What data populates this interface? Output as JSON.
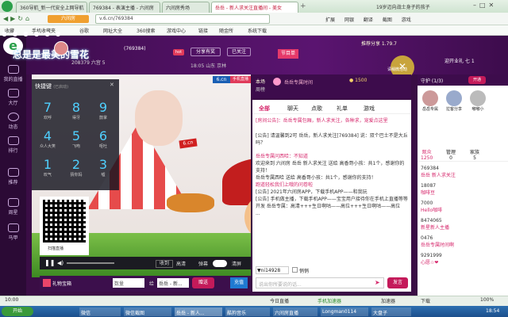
{
  "browser": {
    "tabs": [
      {
        "label": "360导航_新一代安全上网导航",
        "active": false
      },
      {
        "label": "769384 - 表演主播 - 六间房",
        "active": false
      },
      {
        "label": "六间房秀场",
        "active": false
      },
      {
        "label": "岳岳 - 新人求关注直播间 - 美女",
        "active": true
      },
      {
        "label": "19岁迈向战士身子的孩子",
        "active": false
      }
    ],
    "url": "v.6.cn/769384",
    "sidebar_label": "六间房",
    "address_right": [
      "扩展",
      "网银",
      "翻译",
      "截图",
      "游戏"
    ],
    "bookmarks": [
      "收藏",
      "手机收藏夹",
      "谷歌",
      "网址大全",
      "360搜索",
      "游戏中心",
      "链接",
      "随金所",
      "系统下载"
    ]
  },
  "site_sidebar": [
    {
      "label": "我的直播"
    },
    {
      "label": "大厅"
    },
    {
      "label": "动态"
    },
    {
      "label": "排行"
    },
    {
      "label": "推荐"
    },
    {
      "label": "周星"
    },
    {
      "label": "马甲"
    }
  ],
  "header": {
    "overlay_title": "总是是最美的雪花",
    "room_number": "769384",
    "anchor_id": "208379",
    "level_text": "六宫 5",
    "hot_label": "hot",
    "share_label": "分享有奖",
    "follow_label": "已关注",
    "time": "18:05",
    "location_labels": [
      "山东",
      "京林"
    ],
    "room_title": "节目单",
    "recommend_text": "推荐分享 1.79.7",
    "host_reward": "岳岳专属时间",
    "coin": "1500",
    "bubble_text": "请稍微活动",
    "announce": "迎开业礼 七 1"
  },
  "video": {
    "logo": "6.cn",
    "badge": "手机直播",
    "overlay_badge": "6.cn"
  },
  "keypad": {
    "title": "快捷键",
    "subtitle": "(已启动)",
    "keys": [
      {
        "num": "7",
        "label": "欢呼"
      },
      {
        "num": "8",
        "label": "得牙"
      },
      {
        "num": "9",
        "label": "鼓掌"
      },
      {
        "num": "4",
        "label": "众人大笑"
      },
      {
        "num": "5",
        "label": "飞吻"
      },
      {
        "num": "6",
        "label": "呕吐"
      },
      {
        "num": "1",
        "label": "叹气"
      },
      {
        "num": "2",
        "label": "猜你妈"
      },
      {
        "num": "3",
        "label": "嘘"
      }
    ]
  },
  "qr": {
    "label": "扫描直播"
  },
  "controls": {
    "follow": "收到",
    "gift": "高清",
    "hd": "清屏",
    "btn": "弹幕"
  },
  "gift_bar": {
    "gift_label": "礼物宝箱",
    "qty_label": "数量",
    "to_label": "给",
    "to_name": "岳岳 - 新...",
    "send_label": "赠送",
    "recharge_label": "充值"
  },
  "chat": {
    "header_tabs": [
      "本场",
      "周榜"
    ],
    "tabs": [
      "全部",
      "聊天",
      "点歌",
      "礼单",
      "游戏"
    ],
    "lines": [
      "[房间公告]：岳岳专属包厢，新人求关注，各种求，宠爱点这里",
      "",
      "[公告] 请温馨到2可 岳岳，新人求关注[769384] 说：双个巴士不是大丘吗？",
      "",
      "岳岳专属问西哈：不知道",
      "欢迎来到 六间房 岳岳 新人求关注 送给 高香哥小孩：共1个，感谢你的支持！",
      "岳岳专属西哈 送给 高香哥小孩：共1个，感谢你的支持！",
      "跑道轻松我们上哦的问卷啦",
      "[公告] 2021年六间房APP，下载手机APP——和我玩",
      "[公告] 手机做主播，下载手机APP——宝宝用户接待你在手机上直播等等",
      "开发 岳岳专属：高清+++生日啊咕——高位+++生日啊咕——高位",
      "..."
    ],
    "user_mention": "ni14928",
    "input_placeholder": "说出你所要说的话...",
    "checkbox_label": "悄悄",
    "send_label": "发言"
  },
  "right_panel": {
    "guard_label": "守护",
    "guard_count": "1/3",
    "open_guard": "开通",
    "guards": [
      {
        "name": "岳岳专属"
      },
      {
        "name": "拉客分享"
      },
      {
        "name": "嘟嘟小"
      }
    ],
    "tabs": [
      {
        "label": "观众",
        "count": "1250"
      },
      {
        "label": "管理",
        "count": "0"
      },
      {
        "label": "家族",
        "count": "5"
      }
    ],
    "viewers": [
      "769384",
      "岳岳 新人求关注",
      "18087",
      "咖啡豆",
      "7000",
      "Hello咖啡",
      "8474065",
      "新星新人主播",
      "0476",
      "岳岳专属时间啊",
      "9291999",
      "心愿☆❤"
    ]
  },
  "statusbar": {
    "left": "10:00",
    "items": [
      "今日直播",
      "手机加速器",
      "加速器",
      "下载"
    ],
    "zoom": "100%"
  },
  "taskbar": {
    "start": "开始",
    "apps": [
      "微信",
      "微信截图",
      "岳岳 - 新人...",
      "酷狗音乐",
      "六间房直播",
      "Longman0114",
      "大盘子"
    ],
    "clock": "18:54"
  }
}
